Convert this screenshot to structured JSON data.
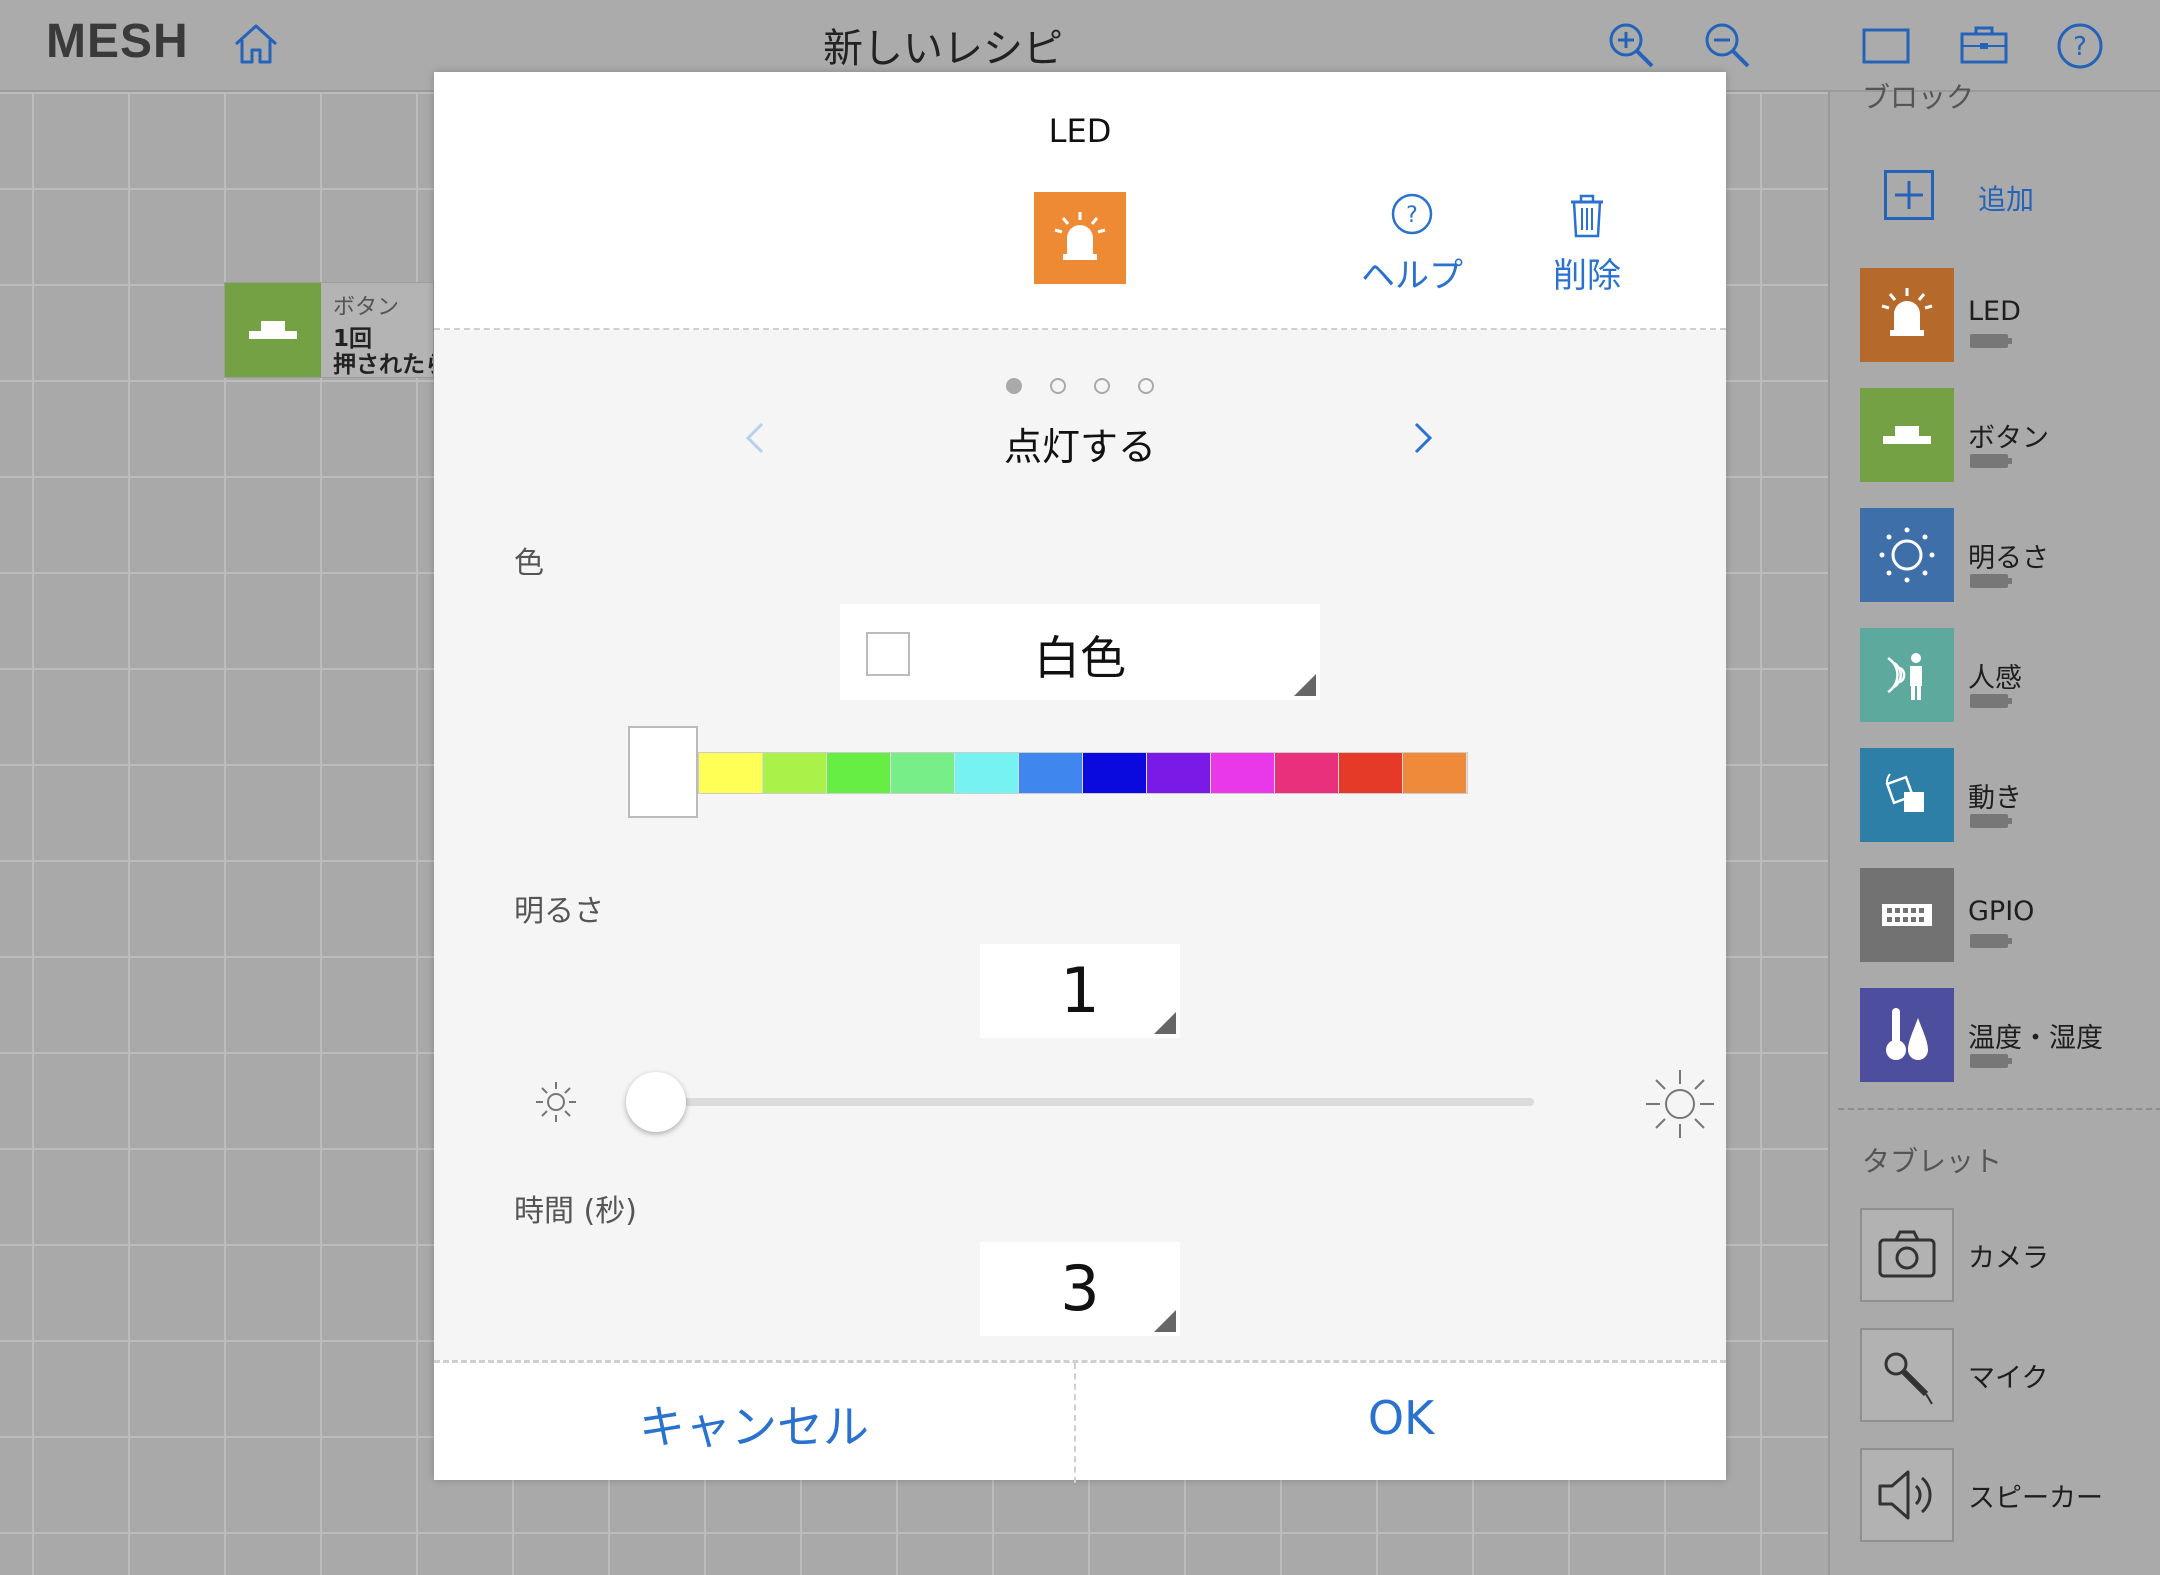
{
  "app": {
    "logo": "MESH",
    "title": "新しいレシピ"
  },
  "canvas_block": {
    "type": "ボタン",
    "line1": "1回",
    "line2": "押されたら"
  },
  "panel": {
    "blocks_header": "ブロック",
    "add_label": "追加",
    "blocks": [
      {
        "name": "LED",
        "color": "#ee8934"
      },
      {
        "name": "ボタン",
        "color": "#73a143"
      },
      {
        "name": "明るさ",
        "color": "#3f74b7"
      },
      {
        "name": "人感",
        "color": "#4fb0a0"
      },
      {
        "name": "動き",
        "color": "#2b8fc0"
      },
      {
        "name": "GPIO",
        "color": "#6f6f6f"
      },
      {
        "name": "温度・湿度",
        "color": "#4e53a8"
      }
    ],
    "tablet_header": "タブレット",
    "tablet_items": [
      {
        "name": "カメラ",
        "icon": "camera-icon"
      },
      {
        "name": "マイク",
        "icon": "microphone-icon"
      },
      {
        "name": "スピーカー",
        "icon": "speaker-icon"
      }
    ]
  },
  "modal": {
    "title": "LED",
    "help_label": "ヘルプ",
    "delete_label": "削除",
    "mode_title": "点灯する",
    "page_count": 4,
    "active_page": 0,
    "color_label": "色",
    "color_value": "白色",
    "palette": [
      "#ffff55",
      "#aaf24a",
      "#66ee44",
      "#77ee88",
      "#77f2f2",
      "#3f86ee",
      "#0a0adf",
      "#7a1ae6",
      "#e838e8",
      "#e8307c",
      "#e53a28",
      "#ee8a3a"
    ],
    "brightness_label": "明るさ",
    "brightness_value": "1",
    "time_label": "時間 (秒)",
    "time_value": "3",
    "cancel_label": "キャンセル",
    "ok_label": "OK"
  },
  "colors": {
    "accent": "#2a72d0"
  }
}
